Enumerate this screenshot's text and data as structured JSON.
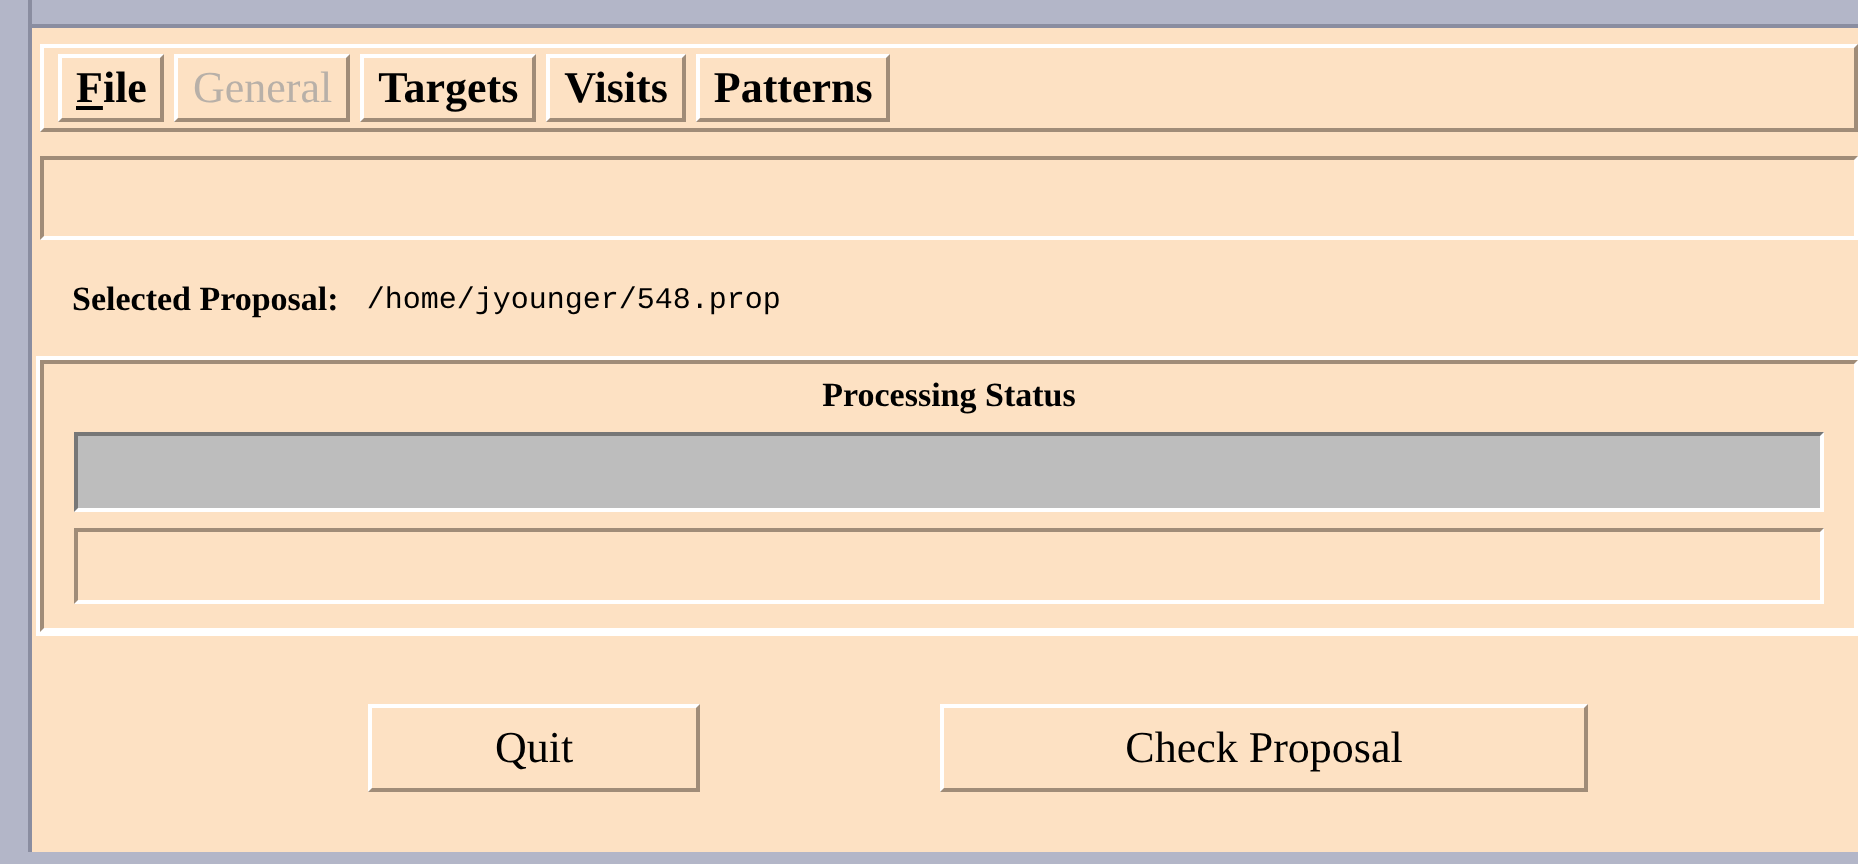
{
  "menu": [
    {
      "label": "File",
      "disabled": false,
      "underline_first": true
    },
    {
      "label": "General",
      "disabled": true,
      "underline_first": false
    },
    {
      "label": "Targets",
      "disabled": false,
      "underline_first": false
    },
    {
      "label": "Visits",
      "disabled": false,
      "underline_first": false
    },
    {
      "label": "Patterns",
      "disabled": false,
      "underline_first": false
    }
  ],
  "selected_proposal": {
    "label": "Selected Proposal:",
    "value": "/home/jyounger/548.prop"
  },
  "processing_status": {
    "title": "Processing Status"
  },
  "buttons": [
    "Quit",
    "Check Proposal"
  ]
}
